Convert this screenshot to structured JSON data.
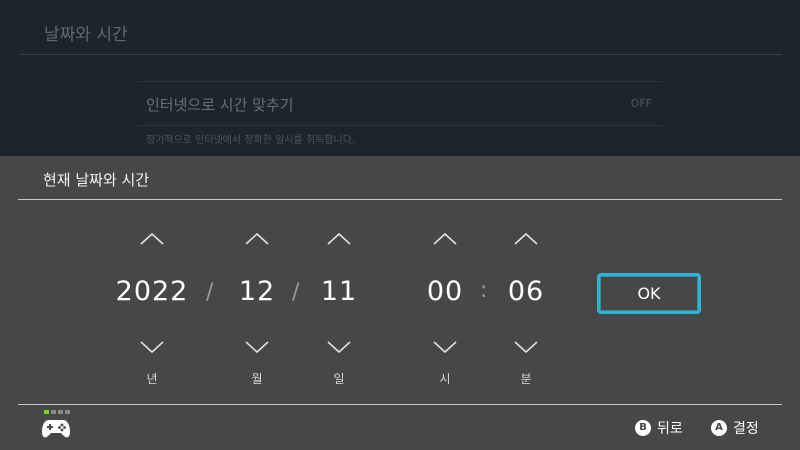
{
  "background": {
    "title": "날짜와 시간",
    "row_label": "인터넷으로 시간 맞추기",
    "row_value": "OFF",
    "row_desc": "정기적으로 인터넷에서 정확한 일시를 취득합니다."
  },
  "dialog": {
    "title": "현재 날짜와 시간",
    "fields": {
      "year": {
        "value": "2022",
        "unit": "년"
      },
      "month": {
        "value": "12",
        "unit": "월"
      },
      "day": {
        "value": "11",
        "unit": "일"
      },
      "hour": {
        "value": "00",
        "unit": "시"
      },
      "minute": {
        "value": "06",
        "unit": "분"
      }
    },
    "date_separator": "/",
    "time_separator": ":",
    "ok_label": "OK"
  },
  "footer": {
    "back_button": "B",
    "back_label": "뒤로",
    "confirm_button": "A",
    "confirm_label": "결정"
  },
  "colors": {
    "accent": "#2fb3d3",
    "dialog_bg": "#474747",
    "page_bg": "#1d242b",
    "active_indicator": "#7fd12c"
  }
}
